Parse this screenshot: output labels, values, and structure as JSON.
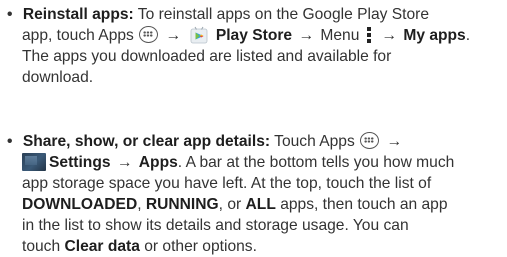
{
  "items": [
    {
      "bullet": "•",
      "lead": "Reinstall apps:",
      "l1_text": " To reinstall apps on the Google Play Store",
      "l2_a": "app, touch Apps",
      "l2_arrow1": "→",
      "l2_store": "Play Store",
      "l2_arrow2": "→",
      "l2_menu": "Menu",
      "l2_arrow3": "→",
      "l2_myapps": "My apps",
      "l2_end": ".",
      "l3": "The apps you downloaded are listed and available for",
      "l4": "download."
    },
    {
      "bullet": "•",
      "lead": "Share, show, or clear app details:",
      "l1_text": " Touch Apps",
      "l1_arrow": "→",
      "l2_settings": "Settings",
      "l2_arrow": "→",
      "l2_apps": "Apps",
      "l2_rest": ". A bar at the bottom tells you how much",
      "l3": "app storage space you have left. At the top, touch the list of",
      "l4_downloaded": "DOWNLOADED",
      "l4_sep1": ", ",
      "l4_running": "RUNNING",
      "l4_sep2": ", or ",
      "l4_all": "ALL",
      "l4_rest": " apps, then touch an app",
      "l5": "in the list to show its details and storage usage. You can",
      "l6_a": "touch ",
      "l6_clear": "Clear data",
      "l6_rest": " or other options."
    }
  ],
  "icons": {
    "apps": "apps-grid-icon",
    "play_store": "play-store-icon",
    "menu": "menu-dots-icon",
    "settings": "settings-icon"
  }
}
